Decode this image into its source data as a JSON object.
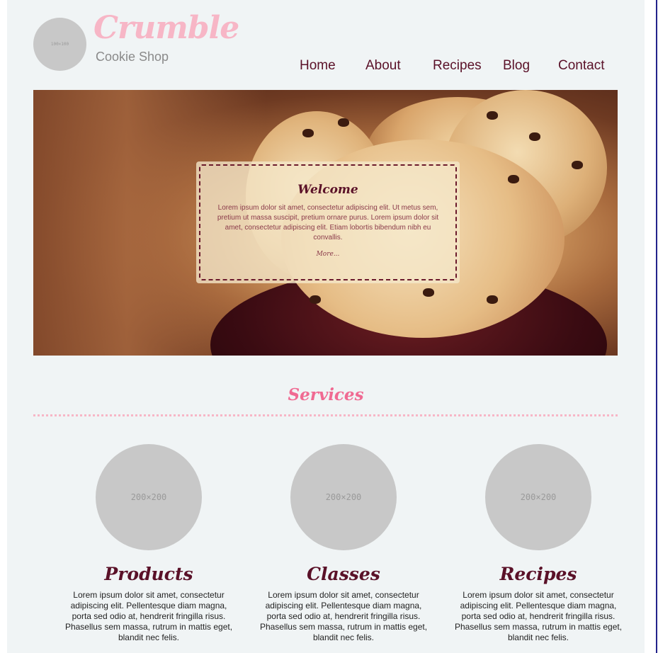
{
  "header": {
    "logo_placeholder": "100×100",
    "brand_title": "Crumble",
    "brand_subtitle": "Cookie Shop"
  },
  "nav": {
    "items": [
      {
        "label": "Home"
      },
      {
        "label": "About"
      },
      {
        "label": "Recipes"
      },
      {
        "label": "Blog"
      },
      {
        "label": "Contact"
      }
    ]
  },
  "hero": {
    "title": "Welcome",
    "text": "Lorem ipsum dolor sit amet, consectetur adipiscing elit. Ut metus sem, pretium ut massa suscipit, pretium ornare purus. Lorem ipsum dolor sit amet, consectetur adipiscing elit. Etiam lobortis bibendum nibh eu convallis.",
    "more_link": "More..."
  },
  "services": {
    "heading": "Services",
    "items": [
      {
        "placeholder": "200×200",
        "title": "Products",
        "text": "Lorem ipsum dolor sit amet, consectetur adipiscing elit. Pellentesque diam magna, porta sed odio at, hendrerit fringilla risus. Phasellus sem massa, rutrum in mattis eget, blandit nec felis."
      },
      {
        "placeholder": "200×200",
        "title": "Classes",
        "text": "Lorem ipsum dolor sit amet, consectetur adipiscing elit. Pellentesque diam magna, porta sed odio at, hendrerit fringilla risus. Phasellus sem massa, rutrum in mattis eget, blandit nec felis."
      },
      {
        "placeholder": "200×200",
        "title": "Recipes",
        "text": "Lorem ipsum dolor sit amet, consectetur adipiscing elit. Pellentesque diam magna, porta sed odio at, hendrerit fringilla risus. Phasellus sem massa, rutrum in mattis eget, blandit nec felis."
      }
    ]
  },
  "colors": {
    "brand_pink": "#f7b6c6",
    "accent_pink": "#f06a92",
    "wine": "#5a1128",
    "background": "#f0f4f5",
    "placeholder_gray": "#c8c8c8"
  }
}
